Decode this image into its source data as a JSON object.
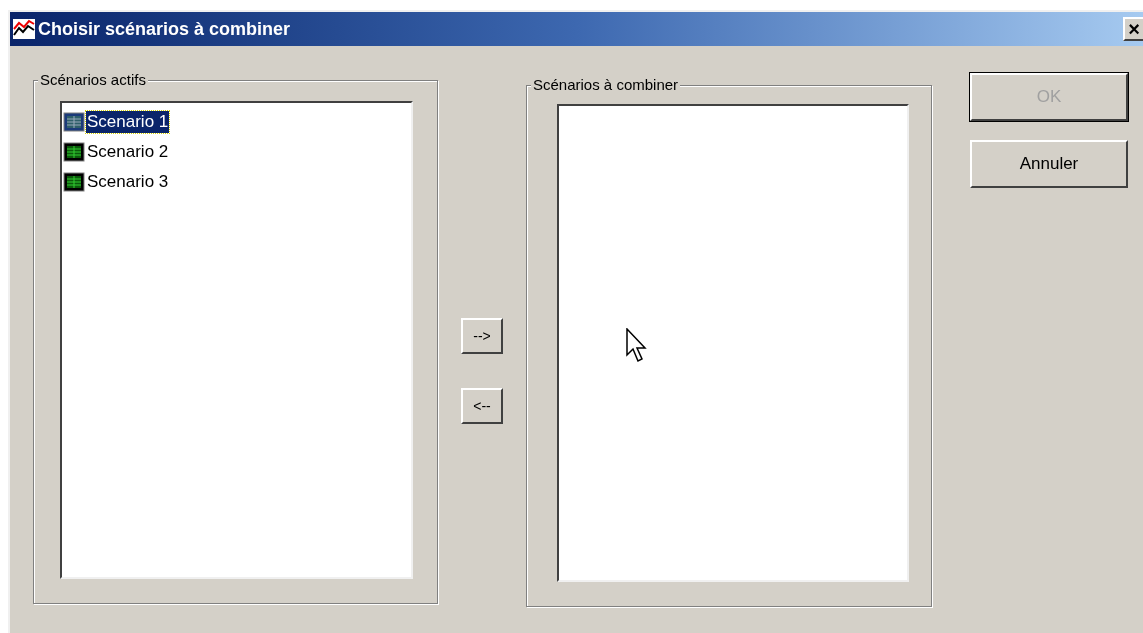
{
  "window": {
    "title": "Choisir scénarios à combiner",
    "close": "×"
  },
  "active_group": {
    "label": "Scénarios actifs",
    "items": [
      {
        "label": "Scenario 1",
        "selected": true
      },
      {
        "label": "Scenario 2",
        "selected": false
      },
      {
        "label": "Scenario 3",
        "selected": false
      }
    ]
  },
  "move_buttons": [
    "-->",
    "<--"
  ],
  "combine_group": {
    "label": "Scénarios à combiner"
  },
  "buttons": [
    {
      "label": "OK",
      "disabled": true
    },
    {
      "label": "Annuler",
      "disabled": false
    }
  ]
}
